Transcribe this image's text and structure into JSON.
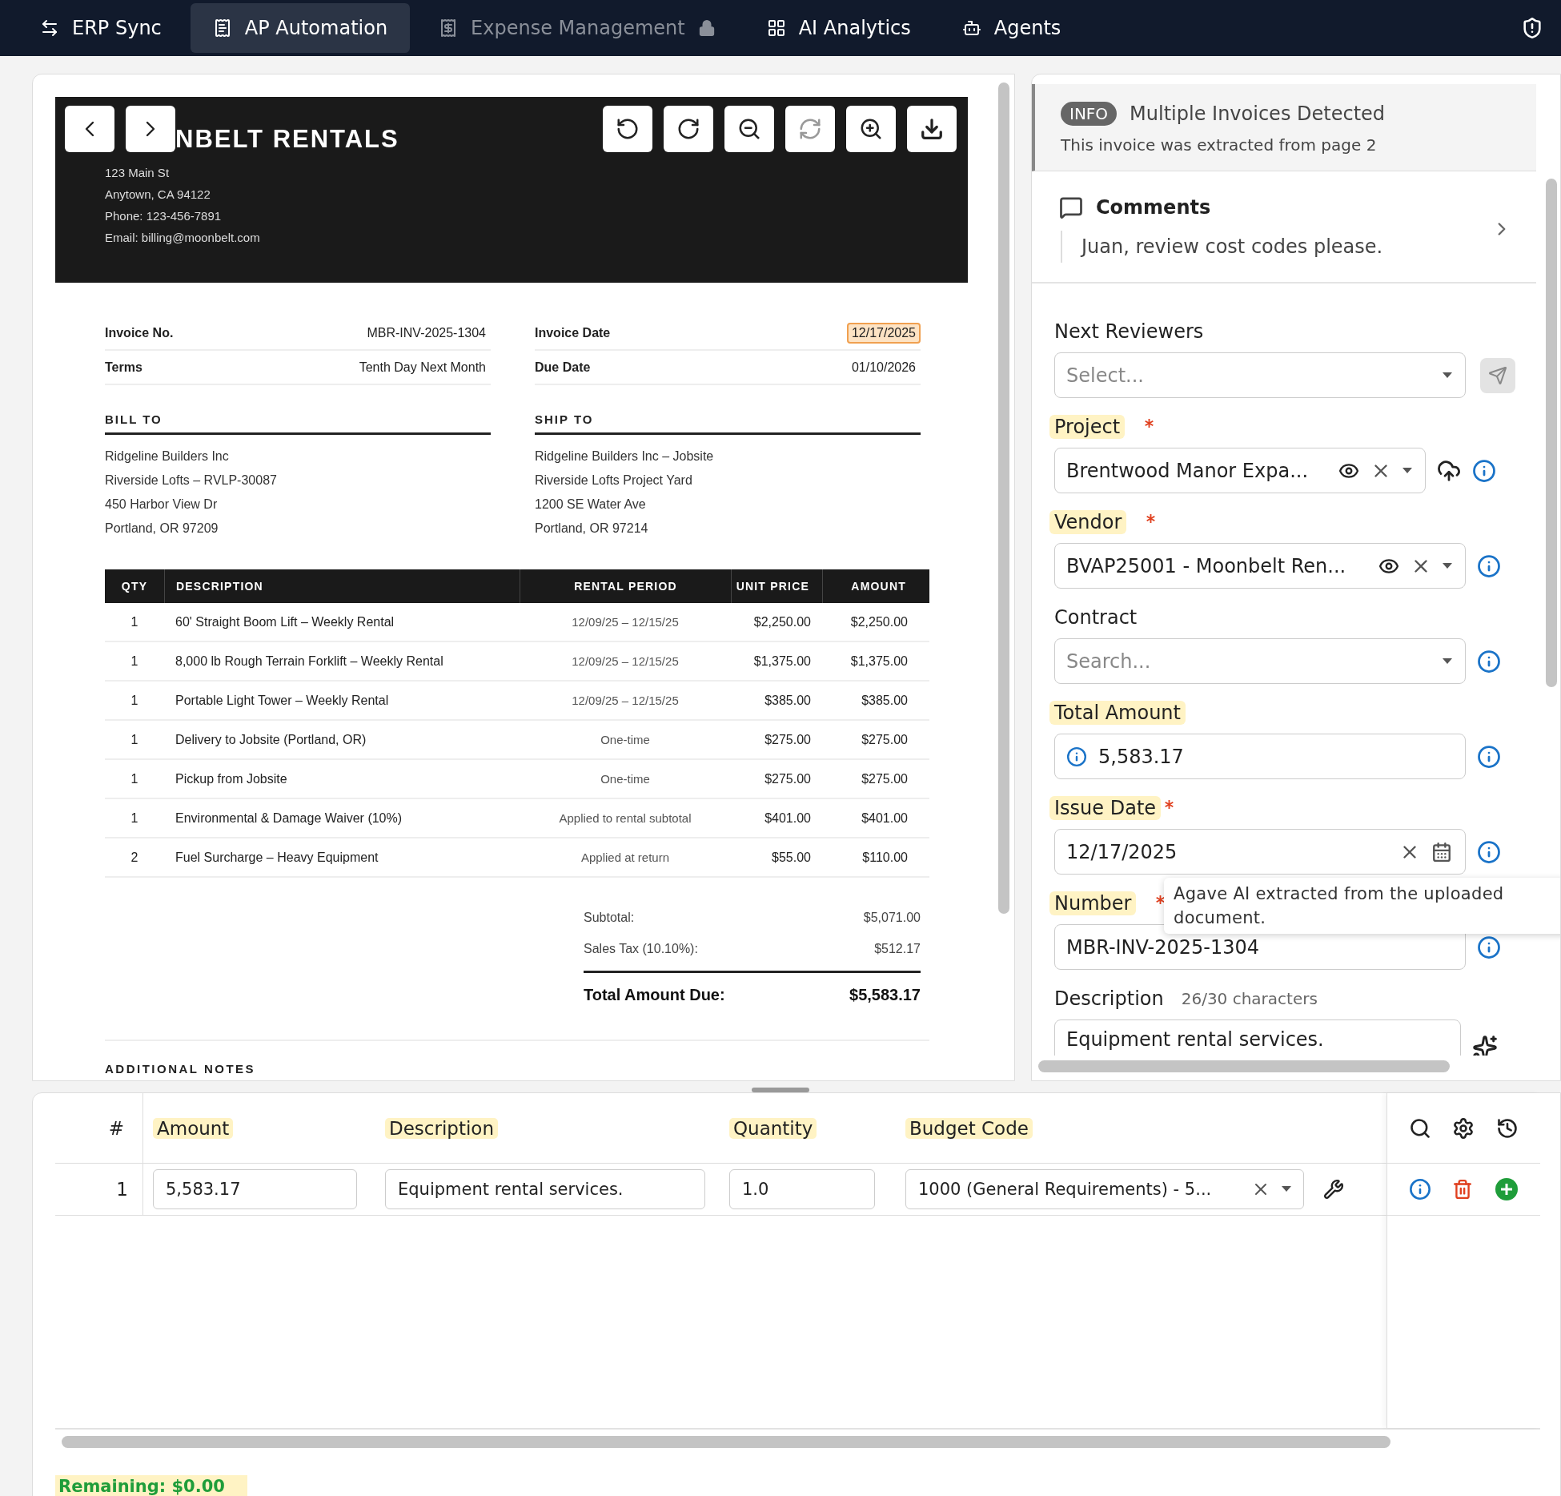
{
  "nav": {
    "tabs": [
      {
        "label": "ERP Sync",
        "selected": false,
        "disabled": false,
        "locked": false
      },
      {
        "label": "AP Automation",
        "selected": true,
        "disabled": false,
        "locked": false
      },
      {
        "label": "Expense Management",
        "selected": false,
        "disabled": true,
        "locked": true
      },
      {
        "label": "AI Analytics",
        "selected": false,
        "disabled": false,
        "locked": false
      },
      {
        "label": "Agents",
        "selected": false,
        "disabled": false,
        "locked": false
      }
    ]
  },
  "document": {
    "company": "NBELT RENTALS",
    "address_lines": [
      "123 Main St",
      "Anytown, CA 94122",
      "Phone: 123-456-7891",
      "Email: billing@moonbelt.com"
    ],
    "meta": [
      {
        "label": "Invoice No.",
        "value": "MBR-INV-2025-1304",
        "highlighted": false
      },
      {
        "label": "Invoice Date",
        "value": "12/17/2025",
        "highlighted": true
      },
      {
        "label": "Terms",
        "value": "Tenth Day Next Month",
        "highlighted": false
      },
      {
        "label": "Due Date",
        "value": "01/10/2026",
        "highlighted": false
      }
    ],
    "parties": [
      {
        "heading": "BILL TO",
        "lines": [
          "Ridgeline Builders Inc",
          "Riverside Lofts – RVLP-30087",
          "450 Harbor View Dr",
          "Portland, OR 97209"
        ]
      },
      {
        "heading": "SHIP TO",
        "lines": [
          "Ridgeline Builders Inc – Jobsite",
          "Riverside Lofts Project Yard",
          "1200 SE Water Ave",
          "Portland, OR 97214"
        ]
      }
    ],
    "table": {
      "columns": [
        "QTY",
        "DESCRIPTION",
        "RENTAL PERIOD",
        "UNIT PRICE",
        "AMOUNT"
      ],
      "rows": [
        [
          "1",
          "60' Straight Boom Lift – Weekly Rental",
          "12/09/25 – 12/15/25",
          "$2,250.00",
          "$2,250.00"
        ],
        [
          "1",
          "8,000 lb Rough Terrain Forklift – Weekly Rental",
          "12/09/25 – 12/15/25",
          "$1,375.00",
          "$1,375.00"
        ],
        [
          "1",
          "Portable Light Tower – Weekly Rental",
          "12/09/25 – 12/15/25",
          "$385.00",
          "$385.00"
        ],
        [
          "1",
          "Delivery to Jobsite (Portland, OR)",
          "One-time",
          "$275.00",
          "$275.00"
        ],
        [
          "1",
          "Pickup from Jobsite",
          "One-time",
          "$275.00",
          "$275.00"
        ],
        [
          "1",
          "Environmental & Damage Waiver (10%)",
          "Applied to rental subtotal",
          "$401.00",
          "$401.00"
        ],
        [
          "2",
          "Fuel Surcharge – Heavy Equipment",
          "Applied at return",
          "$55.00",
          "$110.00"
        ]
      ]
    },
    "totals": [
      {
        "label": "Subtotal:",
        "value": "$5,071.00",
        "kind": "line"
      },
      {
        "label": "Sales Tax (10.10%):",
        "value": "$512.17",
        "kind": "line"
      },
      {
        "label": "Total Amount Due:",
        "value": "$5,583.17",
        "kind": "grand"
      }
    ],
    "notes_heading": "ADDITIONAL NOTES"
  },
  "info_banner": {
    "badge": "INFO",
    "title": "Multiple Invoices Detected",
    "text": "This invoice was extracted from page 2"
  },
  "comments": {
    "title": "Comments",
    "text": "Juan, review cost codes please."
  },
  "fields": [
    {
      "kind": "select",
      "label": "Next Reviewers",
      "placeholder": "Select...",
      "highlighted": false,
      "inner_icons": [
        {
          "kind": "caret"
        }
      ],
      "actions": [
        {
          "kind": "send"
        }
      ]
    },
    {
      "kind": "select",
      "label": "Project",
      "value": "Brentwood Manor Expa...",
      "required": true,
      "highlighted": true,
      "inner_icons": [
        {
          "kind": "eye"
        },
        {
          "kind": "clear"
        },
        {
          "kind": "caret"
        }
      ],
      "actions": [
        {
          "kind": "sync"
        },
        {
          "kind": "info"
        }
      ]
    },
    {
      "kind": "select",
      "label": "Vendor",
      "value": "BVAP25001 - Moonbelt Ren...",
      "required": true,
      "highlighted": true,
      "inner_icons": [
        {
          "kind": "eye"
        },
        {
          "kind": "clear"
        },
        {
          "kind": "caret"
        }
      ],
      "actions": [
        {
          "kind": "info"
        }
      ]
    },
    {
      "kind": "select",
      "label": "Contract",
      "placeholder": "Search...",
      "highlighted": false,
      "inner_icons": [
        {
          "kind": "caret"
        }
      ],
      "actions": [
        {
          "kind": "info"
        }
      ]
    },
    {
      "kind": "amount",
      "label": "Total Amount",
      "value": "5,583.17",
      "highlighted": true,
      "actions": [
        {
          "kind": "info"
        }
      ]
    },
    {
      "kind": "date",
      "label": "Issue Date",
      "value": "12/17/2025",
      "required": true,
      "highlighted": true,
      "inner_icons": [
        {
          "kind": "clear"
        },
        {
          "kind": "calendar"
        }
      ],
      "actions": [
        {
          "kind": "info"
        }
      ]
    },
    {
      "kind": "text",
      "label": "Number",
      "value": "MBR-INV-2025-1304",
      "required": true,
      "highlighted": true,
      "actions": [
        {
          "kind": "info"
        }
      ]
    },
    {
      "kind": "textarea",
      "label": "Description",
      "counter": "26/30 characters",
      "value": "Equipment rental services.",
      "highlighted": false,
      "actions": [
        {
          "kind": "ai"
        }
      ]
    }
  ],
  "tooltip": "Agave AI extracted from the uploaded document.",
  "line_items": {
    "columns": [
      {
        "label": "#",
        "highlighted": false
      },
      {
        "label": "Amount",
        "highlighted": true
      },
      {
        "label": "Description",
        "highlighted": true
      },
      {
        "label": "Quantity",
        "highlighted": true
      },
      {
        "label": "Budget Code",
        "highlighted": true
      }
    ],
    "rows": [
      {
        "number": "1",
        "amount": "5,583.17",
        "description": "Equipment rental services.",
        "quantity": "1.0",
        "budget_code": "1000 (General Requirements) - 5..."
      }
    ]
  },
  "remaining": "Remaining: $0.00"
}
